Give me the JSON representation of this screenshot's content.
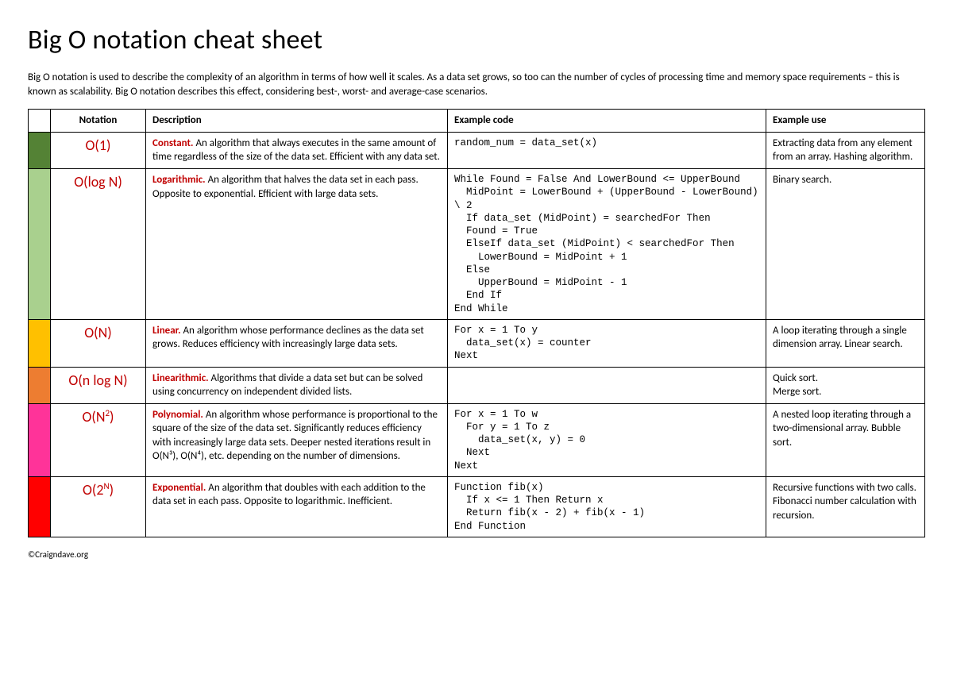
{
  "title": "Big O notation cheat sheet",
  "intro": "Big O notation is used to describe the complexity of an algorithm in terms of how well it scales. As a data set grows, so too can the number of cycles of processing time and memory space requirements – this is known as scalability. Big O notation describes this effect, considering best-, worst- and average-case scenarios.",
  "headers": {
    "notation": "Notation",
    "description": "Description",
    "code": "Example code",
    "use": "Example use"
  },
  "rows": [
    {
      "color": "#548235",
      "notation": "O(1)",
      "term": "Constant.",
      "desc": " An algorithm that always executes in the same amount of time regardless of the size of the data set. Efficient with any data set.",
      "code": "random_num = data_set(x)",
      "use": "Extracting data from any element from an array. Hashing algorithm."
    },
    {
      "color": "#A9D08E",
      "notation": "O(log N)",
      "term": "Logarithmic.",
      "desc": " An algorithm that halves the data set in each pass. Opposite to exponential. Efficient with large data sets.",
      "code": "While Found = False And LowerBound <= UpperBound\n  MidPoint = LowerBound + (UpperBound - LowerBound) \\ 2\n  If data_set (MidPoint) = searchedFor Then\n  Found = True\n  ElseIf data_set (MidPoint) < searchedFor Then\n    LowerBound = MidPoint + 1\n  Else\n    UpperBound = MidPoint - 1\n  End If\nEnd While",
      "use": "Binary search."
    },
    {
      "color": "#FFC000",
      "notation": "O(N)",
      "term": "Linear.",
      "desc": " An algorithm whose performance declines as the data set grows. Reduces efficiency with increasingly large data sets.",
      "code": "For x = 1 To y\n  data_set(x) = counter\nNext",
      "use": "A loop iterating through a single dimension array. Linear search."
    },
    {
      "color": "#ED7D31",
      "notation": "O(n log N)",
      "term": "Linearithmic.",
      "desc": " Algorithms that divide a data set but can be solved using concurrency on independent divided lists.",
      "code": "",
      "use": "Quick sort.\nMerge sort."
    },
    {
      "color": "#FF3399",
      "notation": "O(N<sup>2</sup>)",
      "term": "Polynomial.",
      "desc": " An algorithm whose performance is proportional to the square of the size of the data set. Significantly reduces efficiency with increasingly large data sets. Deeper nested iterations result in O(N³), O(N⁴), etc. depending on the number of dimensions.",
      "code": "For x = 1 To w\n  For y = 1 To z\n    data_set(x, y) = 0\n  Next\nNext",
      "use": "A nested loop iterating through a two-dimensional array. Bubble sort."
    },
    {
      "color": "#FF0000",
      "notation": "O(2<sup>N</sup>)",
      "term": "Exponential.",
      "desc": " An algorithm that doubles with each addition to the data set in each pass. Opposite to logarithmic. Inefficient.",
      "code": "Function fib(x)\n  If x <= 1 Then Return x\n  Return fib(x - 2) + fib(x - 1)\nEnd Function",
      "use": "Recursive functions with two calls. Fibonacci number calculation with recursion."
    }
  ],
  "footer": "©Craigndave.org"
}
